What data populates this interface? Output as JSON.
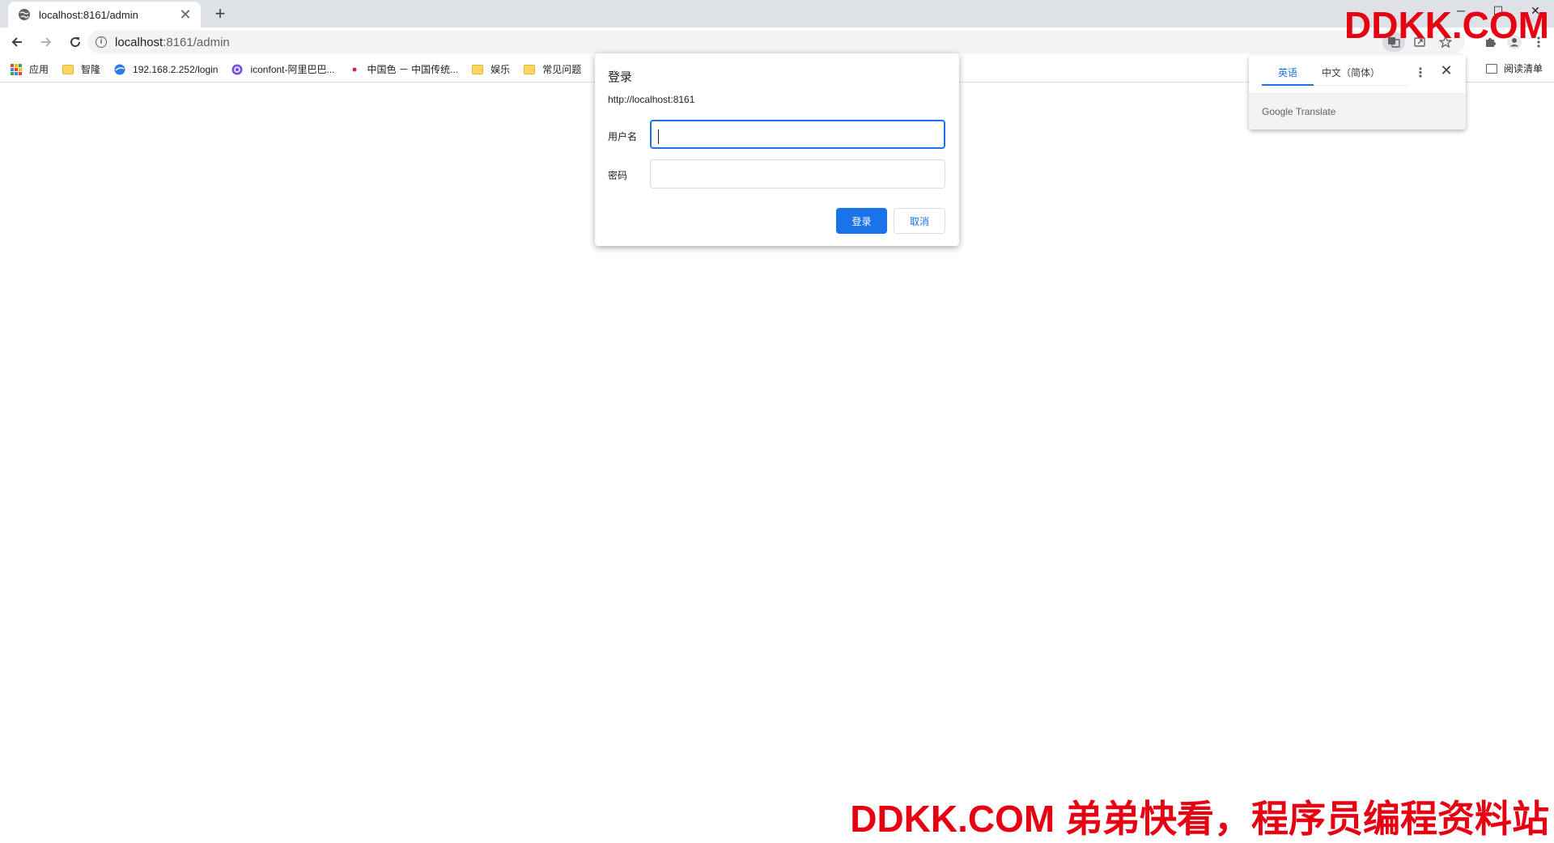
{
  "tab": {
    "title": "localhost:8161/admin",
    "close": "✕",
    "new_tab": "+"
  },
  "window": {
    "minimize": "─",
    "maximize": "☐",
    "close": "✕"
  },
  "address_bar": {
    "host": "localhost",
    "path": ":8161/admin"
  },
  "bookmarks": {
    "items": [
      {
        "label": "应用",
        "icon": "apps-grid-icon"
      },
      {
        "label": "智隆",
        "icon": "folder-icon"
      },
      {
        "label": "192.168.2.252/login",
        "icon": "site-icon"
      },
      {
        "label": "iconfont-阿里巴巴...",
        "icon": "iconfont-icon"
      },
      {
        "label": "中国色 － 中国传统...",
        "icon": "dot-icon"
      },
      {
        "label": "娱乐",
        "icon": "folder-icon"
      },
      {
        "label": "常见问题",
        "icon": "folder-icon"
      }
    ],
    "reading_list": "阅读清单"
  },
  "auth_dialog": {
    "title": "登录",
    "origin": "http://localhost:8161",
    "username_label": "用户名",
    "username_value": "",
    "password_label": "密码",
    "password_value": "",
    "submit_label": "登录",
    "cancel_label": "取消"
  },
  "translate_bubble": {
    "tab_source": "英语",
    "tab_target": "中文（简体）",
    "more": "⋮",
    "close": "✕",
    "footer": "Google Translate"
  },
  "watermark": {
    "top": "DDKK.COM",
    "bottom": "DDKK.COM 弟弟快看，程序员编程资料站"
  },
  "colors": {
    "accent": "#1a73e8",
    "watermark": "#e60012",
    "tabstrip": "#dee1e6"
  }
}
